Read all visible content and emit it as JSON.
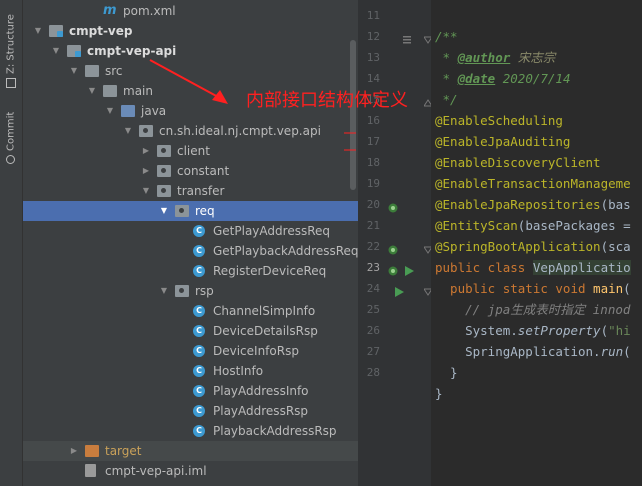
{
  "side_tabs": {
    "structure": "Z: Structure",
    "commit": "Commit"
  },
  "tree": [
    {
      "label": "pom.xml",
      "icon": "maven-m-icon",
      "arrow": ""
    },
    {
      "label": "cmpt-vep",
      "icon": "module-folder-icon",
      "arrow": "down",
      "bold": true
    },
    {
      "label": "cmpt-vep-api",
      "icon": "module-folder-icon",
      "arrow": "down",
      "bold": true
    },
    {
      "label": "src",
      "icon": "folder-icon",
      "arrow": "down"
    },
    {
      "label": "main",
      "icon": "folder-icon",
      "arrow": "down"
    },
    {
      "label": "java",
      "icon": "source-folder-icon",
      "arrow": "down"
    },
    {
      "label": "cn.sh.ideal.nj.cmpt.vep.api",
      "icon": "package-icon",
      "arrow": "down"
    },
    {
      "label": "client",
      "icon": "package-icon",
      "arrow": "right"
    },
    {
      "label": "constant",
      "icon": "package-icon",
      "arrow": "right"
    },
    {
      "label": "transfer",
      "icon": "package-icon",
      "arrow": "down"
    },
    {
      "label": "req",
      "icon": "package-icon",
      "arrow": "down",
      "selected": true
    },
    {
      "label": "GetPlayAddressReq",
      "icon": "class-icon",
      "arrow": ""
    },
    {
      "label": "GetPlaybackAddressReq",
      "icon": "class-icon",
      "arrow": ""
    },
    {
      "label": "RegisterDeviceReq",
      "icon": "class-icon",
      "arrow": ""
    },
    {
      "label": "rsp",
      "icon": "package-icon",
      "arrow": "down"
    },
    {
      "label": "ChannelSimpInfo",
      "icon": "class-icon",
      "arrow": ""
    },
    {
      "label": "DeviceDetailsRsp",
      "icon": "class-icon",
      "arrow": ""
    },
    {
      "label": "DeviceInfoRsp",
      "icon": "class-icon",
      "arrow": ""
    },
    {
      "label": "HostInfo",
      "icon": "class-icon",
      "arrow": ""
    },
    {
      "label": "PlayAddressInfo",
      "icon": "class-icon",
      "arrow": ""
    },
    {
      "label": "PlayAddressRsp",
      "icon": "class-icon",
      "arrow": ""
    },
    {
      "label": "PlaybackAddressRsp",
      "icon": "class-icon",
      "arrow": ""
    },
    {
      "label": "target",
      "icon": "excluded-folder-icon",
      "arrow": "right",
      "highlight": true
    },
    {
      "label": "cmpt-vep-api.iml",
      "icon": "iml-file-icon",
      "arrow": ""
    }
  ],
  "line_numbers": [
    "11",
    "12",
    "13",
    "14",
    "15",
    "16",
    "17",
    "18",
    "19",
    "20",
    "21",
    "22",
    "23",
    "24",
    "25",
    "26",
    "27",
    "28"
  ],
  "current_line": "23",
  "code": {
    "l12_open": "/**",
    "l13_star": " * ",
    "l13_tag": "@author",
    "l13_val": " 宋志宗",
    "l14_star": " * ",
    "l14_tag": "@date",
    "l14_val": " 2020/7/14",
    "l15": " */",
    "l16": "@EnableScheduling",
    "l17": "@EnableJpaAuditing",
    "l18": "@EnableDiscoveryClient",
    "l19": "@EnableTransactionManageme",
    "l20_ann": "@EnableJpaRepositories",
    "l20_rest": "(bas",
    "l21_ann": "@EntityScan",
    "l21_rest": "(basePackages =",
    "l22_ann": "@SpringBootApplication",
    "l22_rest": "(sca",
    "l23_kw": "public class ",
    "l23_name": "VepApplicatio",
    "l24_kw": "  public static void ",
    "l24_fn": "main",
    "l24_rest": "(",
    "l25": "    // jpa生成表时指定 innod",
    "l26_a": "    System.",
    "l26_fn": "setProperty",
    "l26_b": "(",
    "l26_str": "\"hi",
    "l27_a": "    SpringApplication.",
    "l27_fn": "run",
    "l27_b": "(",
    "l28": "  }",
    "l29": "}"
  },
  "annotation_text": "内部接口结构体定义",
  "colors": {
    "selection": "#4b6eaf",
    "annotation": "#ff2020",
    "annotation_code": "#bbb529",
    "keyword": "#cc7832"
  }
}
